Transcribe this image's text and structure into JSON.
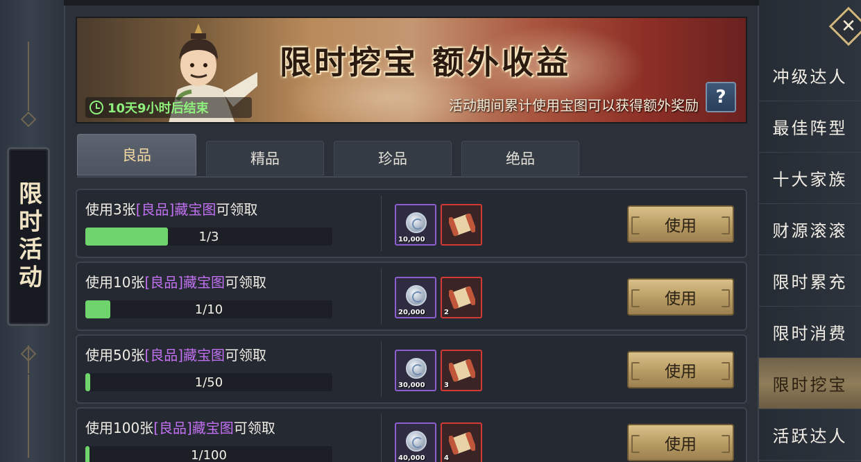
{
  "sidebar_title": "限时活动",
  "banner": {
    "title": "限时挖宝 额外收益",
    "description": "活动期间累计使用宝图可以获得额外奖励",
    "timer": "10天9小时后结束",
    "help_label": "?"
  },
  "tabs": [
    {
      "label": "良品",
      "active": true
    },
    {
      "label": "精品",
      "active": false
    },
    {
      "label": "珍品",
      "active": false
    },
    {
      "label": "绝品",
      "active": false
    }
  ],
  "rows": [
    {
      "prefix": "使用3张",
      "highlight": "[良品]藏宝图",
      "suffix": "可领取",
      "progress_text": "1/3",
      "progress": 0.333,
      "rewards": [
        {
          "icon": "silver-coin-icon",
          "count": "10,000"
        },
        {
          "icon": "treasure-map-scroll-icon",
          "count": ""
        }
      ],
      "button": "使用"
    },
    {
      "prefix": "使用10张",
      "highlight": "[良品]藏宝图",
      "suffix": "可领取",
      "progress_text": "1/10",
      "progress": 0.1,
      "rewards": [
        {
          "icon": "silver-coin-icon",
          "count": "20,000"
        },
        {
          "icon": "treasure-map-scroll-icon",
          "count": "2"
        }
      ],
      "button": "使用"
    },
    {
      "prefix": "使用50张",
      "highlight": "[良品]藏宝图",
      "suffix": "可领取",
      "progress_text": "1/50",
      "progress": 0.02,
      "rewards": [
        {
          "icon": "silver-coin-icon",
          "count": "30,000"
        },
        {
          "icon": "treasure-map-scroll-icon",
          "count": "3"
        }
      ],
      "button": "使用"
    },
    {
      "prefix": "使用100张",
      "highlight": "[良品]藏宝图",
      "suffix": "可领取",
      "progress_text": "1/100",
      "progress": 0.01,
      "rewards": [
        {
          "icon": "silver-coin-icon",
          "count": "40,000"
        },
        {
          "icon": "treasure-map-scroll-icon",
          "count": "4"
        }
      ],
      "button": "使用"
    }
  ],
  "side_menu": [
    {
      "label": "冲级达人",
      "active": false
    },
    {
      "label": "最佳阵型",
      "active": false
    },
    {
      "label": "十大家族",
      "active": false
    },
    {
      "label": "财源滚滚",
      "active": false
    },
    {
      "label": "限时累充",
      "active": false
    },
    {
      "label": "限时消费",
      "active": false
    },
    {
      "label": "限时挖宝",
      "active": true
    },
    {
      "label": "活跃达人",
      "active": false
    }
  ],
  "close_label": "✕",
  "colors": {
    "highlight_purple": "#c070f0",
    "progress_green": "#6fd46c",
    "timer_green": "#8ef07c",
    "gold_button": "#c9ae74"
  }
}
